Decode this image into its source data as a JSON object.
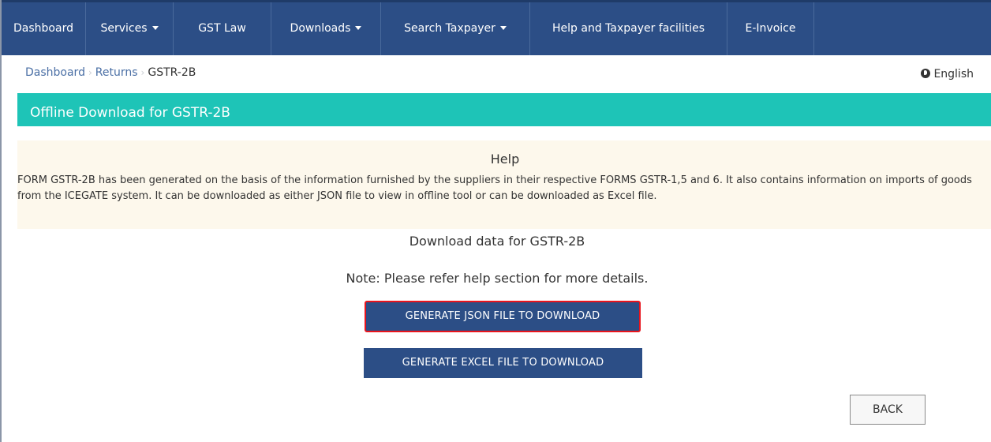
{
  "nav": {
    "dashboard": "Dashboard",
    "services": "Services",
    "gst_law": "GST Law",
    "downloads": "Downloads",
    "search_taxpayer": "Search Taxpayer",
    "help_facilities": "Help and Taxpayer facilities",
    "einvoice": "E-Invoice"
  },
  "breadcrumb": {
    "dashboard": "Dashboard",
    "returns": "Returns",
    "current": "GSTR-2B"
  },
  "language": {
    "label": "English",
    "icon": "globe-icon"
  },
  "section": {
    "title": "Offline Download for GSTR-2B"
  },
  "help": {
    "title": "Help",
    "text": "FORM GSTR-2B has been generated on the basis of the information furnished by the suppliers in their respective FORMS GSTR-1,5 and 6. It also contains information on imports of goods from the ICEGATE system. It can be downloaded as either JSON file to view in offline tool or can be downloaded as Excel file."
  },
  "download": {
    "title": "Download data for GSTR-2B",
    "note": "Note: Please refer help section for more details."
  },
  "buttons": {
    "json": "GENERATE JSON FILE TO DOWNLOAD",
    "excel": "GENERATE EXCEL FILE TO DOWNLOAD",
    "back": "BACK"
  },
  "colors": {
    "nav_bg": "#2c4e86",
    "section_header": "#1ec4b7",
    "help_bg": "#fdf8ec",
    "highlight_border": "#e8141c",
    "link": "#4a6fa5"
  }
}
